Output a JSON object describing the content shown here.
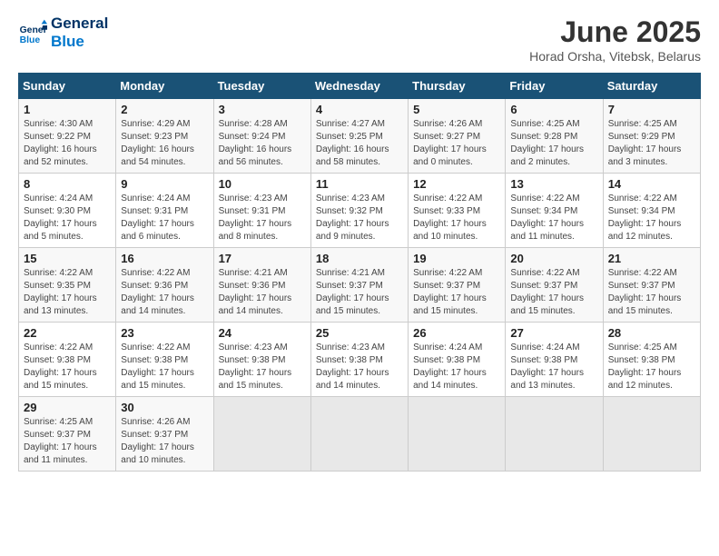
{
  "header": {
    "logo_line1": "General",
    "logo_line2": "Blue",
    "month_title": "June 2025",
    "location": "Horad Orsha, Vitebsk, Belarus"
  },
  "days_of_week": [
    "Sunday",
    "Monday",
    "Tuesday",
    "Wednesday",
    "Thursday",
    "Friday",
    "Saturday"
  ],
  "weeks": [
    [
      {
        "num": "1",
        "rise": "4:30 AM",
        "set": "9:22 PM",
        "daylight": "16 hours and 52 minutes."
      },
      {
        "num": "2",
        "rise": "4:29 AM",
        "set": "9:23 PM",
        "daylight": "16 hours and 54 minutes."
      },
      {
        "num": "3",
        "rise": "4:28 AM",
        "set": "9:24 PM",
        "daylight": "16 hours and 56 minutes."
      },
      {
        "num": "4",
        "rise": "4:27 AM",
        "set": "9:25 PM",
        "daylight": "16 hours and 58 minutes."
      },
      {
        "num": "5",
        "rise": "4:26 AM",
        "set": "9:27 PM",
        "daylight": "17 hours and 0 minutes."
      },
      {
        "num": "6",
        "rise": "4:25 AM",
        "set": "9:28 PM",
        "daylight": "17 hours and 2 minutes."
      },
      {
        "num": "7",
        "rise": "4:25 AM",
        "set": "9:29 PM",
        "daylight": "17 hours and 3 minutes."
      }
    ],
    [
      {
        "num": "8",
        "rise": "4:24 AM",
        "set": "9:30 PM",
        "daylight": "17 hours and 5 minutes."
      },
      {
        "num": "9",
        "rise": "4:24 AM",
        "set": "9:31 PM",
        "daylight": "17 hours and 6 minutes."
      },
      {
        "num": "10",
        "rise": "4:23 AM",
        "set": "9:31 PM",
        "daylight": "17 hours and 8 minutes."
      },
      {
        "num": "11",
        "rise": "4:23 AM",
        "set": "9:32 PM",
        "daylight": "17 hours and 9 minutes."
      },
      {
        "num": "12",
        "rise": "4:22 AM",
        "set": "9:33 PM",
        "daylight": "17 hours and 10 minutes."
      },
      {
        "num": "13",
        "rise": "4:22 AM",
        "set": "9:34 PM",
        "daylight": "17 hours and 11 minutes."
      },
      {
        "num": "14",
        "rise": "4:22 AM",
        "set": "9:34 PM",
        "daylight": "17 hours and 12 minutes."
      }
    ],
    [
      {
        "num": "15",
        "rise": "4:22 AM",
        "set": "9:35 PM",
        "daylight": "17 hours and 13 minutes."
      },
      {
        "num": "16",
        "rise": "4:22 AM",
        "set": "9:36 PM",
        "daylight": "17 hours and 14 minutes."
      },
      {
        "num": "17",
        "rise": "4:21 AM",
        "set": "9:36 PM",
        "daylight": "17 hours and 14 minutes."
      },
      {
        "num": "18",
        "rise": "4:21 AM",
        "set": "9:37 PM",
        "daylight": "17 hours and 15 minutes."
      },
      {
        "num": "19",
        "rise": "4:22 AM",
        "set": "9:37 PM",
        "daylight": "17 hours and 15 minutes."
      },
      {
        "num": "20",
        "rise": "4:22 AM",
        "set": "9:37 PM",
        "daylight": "17 hours and 15 minutes."
      },
      {
        "num": "21",
        "rise": "4:22 AM",
        "set": "9:37 PM",
        "daylight": "17 hours and 15 minutes."
      }
    ],
    [
      {
        "num": "22",
        "rise": "4:22 AM",
        "set": "9:38 PM",
        "daylight": "17 hours and 15 minutes."
      },
      {
        "num": "23",
        "rise": "4:22 AM",
        "set": "9:38 PM",
        "daylight": "17 hours and 15 minutes."
      },
      {
        "num": "24",
        "rise": "4:23 AM",
        "set": "9:38 PM",
        "daylight": "17 hours and 15 minutes."
      },
      {
        "num": "25",
        "rise": "4:23 AM",
        "set": "9:38 PM",
        "daylight": "17 hours and 14 minutes."
      },
      {
        "num": "26",
        "rise": "4:24 AM",
        "set": "9:38 PM",
        "daylight": "17 hours and 14 minutes."
      },
      {
        "num": "27",
        "rise": "4:24 AM",
        "set": "9:38 PM",
        "daylight": "17 hours and 13 minutes."
      },
      {
        "num": "28",
        "rise": "4:25 AM",
        "set": "9:38 PM",
        "daylight": "17 hours and 12 minutes."
      }
    ],
    [
      {
        "num": "29",
        "rise": "4:25 AM",
        "set": "9:37 PM",
        "daylight": "17 hours and 11 minutes."
      },
      {
        "num": "30",
        "rise": "4:26 AM",
        "set": "9:37 PM",
        "daylight": "17 hours and 10 minutes."
      },
      null,
      null,
      null,
      null,
      null
    ]
  ]
}
